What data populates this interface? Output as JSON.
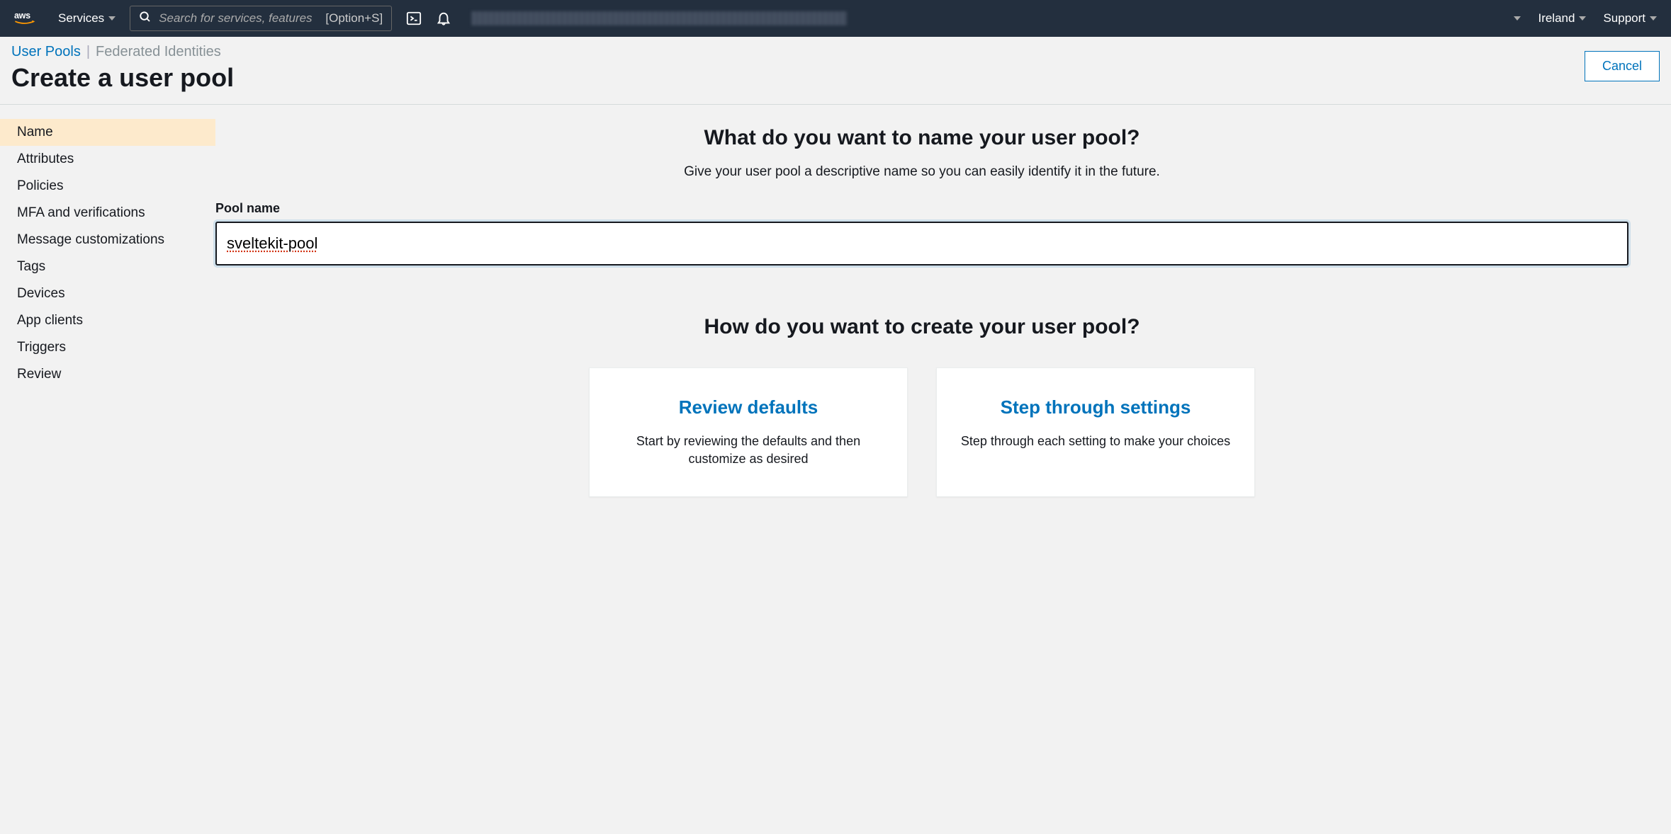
{
  "topnav": {
    "services_label": "Services",
    "search_placeholder": "Search for services, features",
    "search_shortcut": "[Option+S]",
    "region": "Ireland",
    "support": "Support"
  },
  "header": {
    "breadcrumb_link": "User Pools",
    "breadcrumb_text": "Federated Identities",
    "title": "Create a user pool",
    "cancel_label": "Cancel"
  },
  "sidebar": {
    "items": [
      "Name",
      "Attributes",
      "Policies",
      "MFA and verifications",
      "Message customizations",
      "Tags",
      "Devices",
      "App clients",
      "Triggers",
      "Review"
    ]
  },
  "content": {
    "name_heading": "What do you want to name your user pool?",
    "name_subtext": "Give your user pool a descriptive name so you can easily identify it in the future.",
    "field_label": "Pool name",
    "pool_name_value": "sveltekit-pool",
    "create_heading": "How do you want to create your user pool?",
    "option1_title": "Review defaults",
    "option1_desc": "Start by reviewing the defaults and then customize as desired",
    "option2_title": "Step through settings",
    "option2_desc": "Step through each setting to make your choices"
  }
}
